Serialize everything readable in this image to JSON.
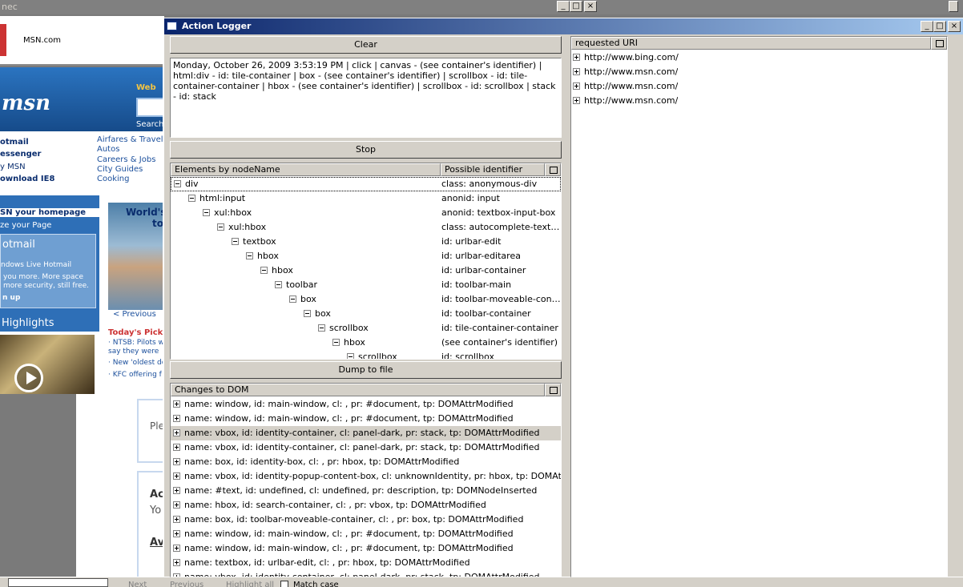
{
  "background_browser": {
    "title_fragment": "nec",
    "header_tab": "MSN.com",
    "logo": "msn",
    "search_web_label": "Web",
    "search_button": "Search",
    "left_links": [
      "otmail",
      "essenger",
      "y MSN",
      "ownload IE8"
    ],
    "right_links": [
      "Airfares & Travel",
      "Autos",
      "Careers & Jobs",
      "City Guides",
      "Cooking"
    ],
    "homepage_link": "SN your homepage",
    "customize": "ze your Page",
    "hotmail_title": "otmail",
    "hotmail_sub": "ndows Live Hotmail",
    "hotmail_desc1": "you more. More space",
    "hotmail_desc2": "more security, still free.",
    "signup": "n up",
    "highlights": "Highlights",
    "worlds_title": "World's",
    "worlds_to": "to",
    "previous": "< Previous",
    "todays_picks": "Today's Picks",
    "news": [
      "· NTSB: Pilots w",
      "  say they were",
      "· New 'oldest do",
      "· KFC offering f"
    ],
    "page2_ple": "Ple",
    "page2_ac": "Ac",
    "page2_yo": "Yo",
    "page2_av": "Av",
    "findbar": {
      "next": "Next",
      "previous": "Previous",
      "highlight": "Highlight all",
      "match_case": "Match case"
    }
  },
  "logger": {
    "title": "Action Logger",
    "clear_button": "Clear",
    "log_text": "Monday, October 26, 2009 3:53:19 PM | click | canvas - (see container's identifier) | html:div - id: tile-container | box - (see container's identifier) | scrollbox - id: tile-container-container | hbox - (see container's identifier) | scrollbox - id: scrollbox | stack - id: stack",
    "stop_button": "Stop",
    "dump_button": "Dump to file",
    "elements_tree": {
      "col1": "Elements by nodeName",
      "col2": "Possible identifier",
      "rows": [
        {
          "node": "div",
          "id": "class: anonymous-div"
        },
        {
          "node": "html:input",
          "id": "anonid: input"
        },
        {
          "node": "xul:hbox",
          "id": "anonid: textbox-input-box"
        },
        {
          "node": "xul:hbox",
          "id": "class: autocomplete-textbox-container"
        },
        {
          "node": "textbox",
          "id": "id: urlbar-edit"
        },
        {
          "node": "hbox",
          "id": "id: urlbar-editarea"
        },
        {
          "node": "hbox",
          "id": "id: urlbar-container"
        },
        {
          "node": "toolbar",
          "id": "id: toolbar-main"
        },
        {
          "node": "box",
          "id": "id: toolbar-moveable-container"
        },
        {
          "node": "box",
          "id": "id: toolbar-container"
        },
        {
          "node": "scrollbox",
          "id": "id: tile-container-container"
        },
        {
          "node": "hbox",
          "id": "(see container's identifier)"
        },
        {
          "node": "scrollbox",
          "id": "id: scrollbox"
        }
      ]
    },
    "dom_tree": {
      "col1": "Changes to DOM",
      "rows": [
        "name: window, id: main-window, cl: , pr: #document, tp: DOMAttrModified",
        "name: window, id: main-window, cl: , pr: #document, tp: DOMAttrModified",
        "name: vbox, id: identity-container, cl: panel-dark, pr: stack, tp: DOMAttrModified",
        "name: vbox, id: identity-container, cl: panel-dark, pr: stack, tp: DOMAttrModified",
        "name: box, id: identity-box, cl: , pr: hbox, tp: DOMAttrModified",
        "name: vbox, id: identity-popup-content-box, cl: unknownIdentity, pr: hbox, tp: DOMAttrModified",
        "name: #text, id: undefined, cl: undefined, pr: description, tp: DOMNodeInserted",
        "name: hbox, id: search-container, cl: , pr: vbox, tp: DOMAttrModified",
        "name: box, id: toolbar-moveable-container, cl: , pr: box, tp: DOMAttrModified",
        "name: window, id: main-window, cl: , pr: #document, tp: DOMAttrModified",
        "name: window, id: main-window, cl: , pr: #document, tp: DOMAttrModified",
        "name: textbox, id: urlbar-edit, cl: , pr: hbox, tp: DOMAttrModified",
        "name: vbox, id: identity-container, cl: panel-dark, pr: stack, tp: DOMAttrModified"
      ]
    },
    "uri_tree": {
      "col1": "requested URI",
      "rows": [
        "http://www.bing.com/",
        "http://www.msn.com/",
        "http://www.msn.com/",
        "http://www.msn.com/"
      ]
    }
  }
}
